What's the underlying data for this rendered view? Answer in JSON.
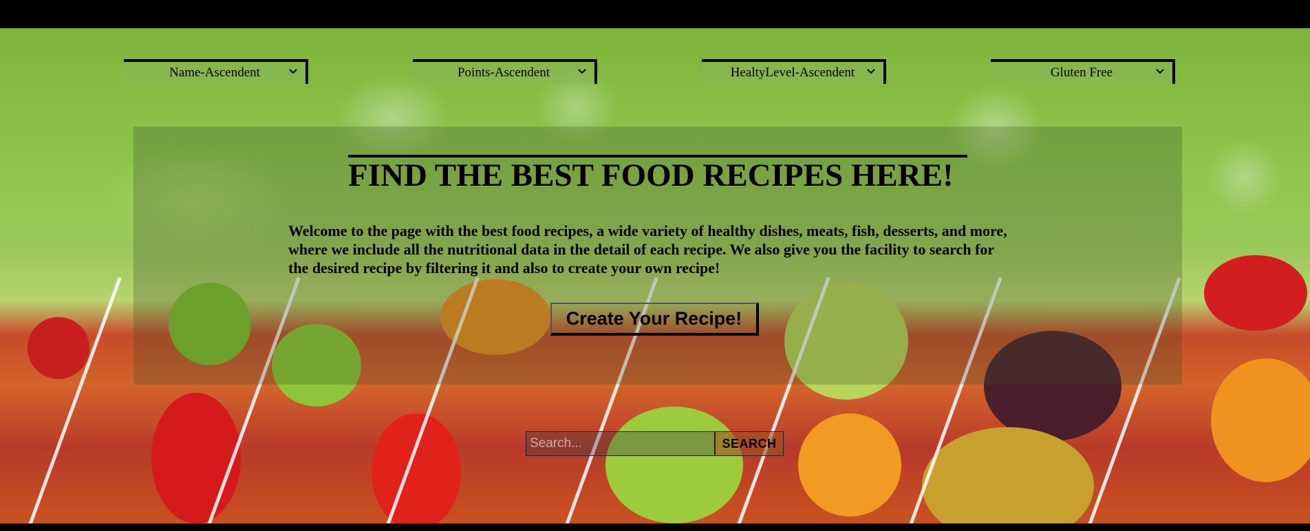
{
  "filters": [
    {
      "label": "Name-Ascendent"
    },
    {
      "label": "Points-Ascendent"
    },
    {
      "label": "HealtyLevel-Ascendent"
    },
    {
      "label": "Gluten Free"
    }
  ],
  "hero": {
    "title": "FIND THE BEST FOOD RECIPES HERE!",
    "intro": "Welcome to the page with the best food recipes, a wide variety of healthy dishes, meats, fish, desserts, and more, where we include all the nutritional data in the detail of each recipe. We also give you the facility to search for the desired recipe by filtering it and also to create your own recipe!",
    "create_label": "Create Your Recipe!"
  },
  "search": {
    "placeholder": "Search...",
    "button_label": "SEARCH"
  }
}
